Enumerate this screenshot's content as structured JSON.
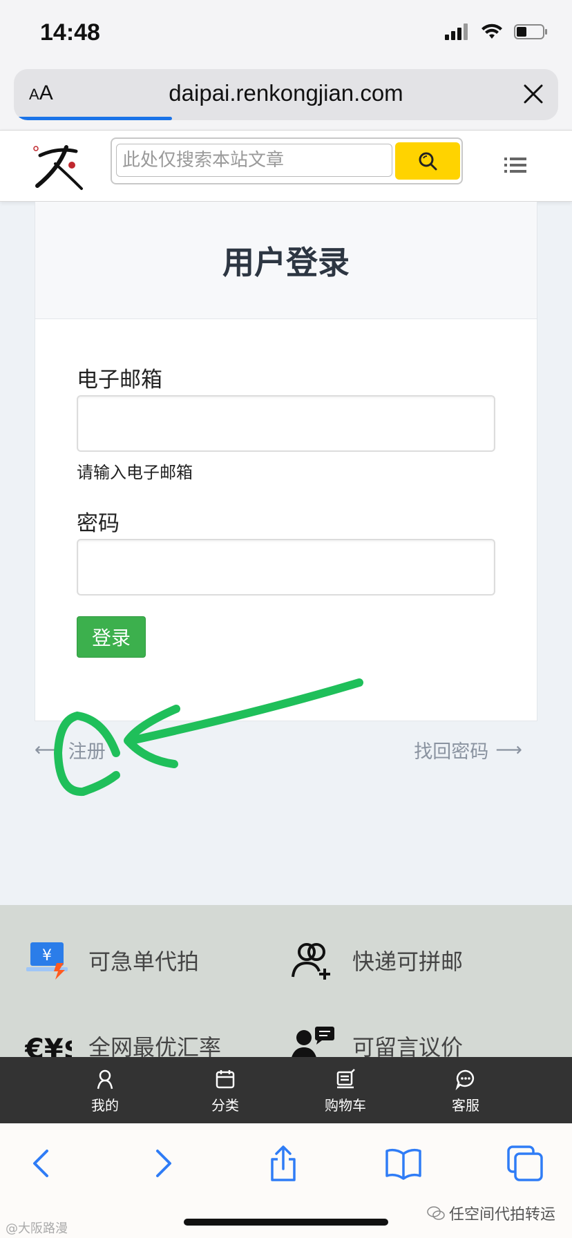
{
  "status_bar": {
    "time": "14:48"
  },
  "browser": {
    "aa_label_small": "A",
    "aa_label_big": "A",
    "url": "daipai.renkongjian.com",
    "load_progress": 0.29
  },
  "site_header": {
    "search_placeholder": "此处仅搜索本站文章",
    "search_icon": "search-icon",
    "menu_icon": "menu-list-icon",
    "accent_color": "#ffd300"
  },
  "login": {
    "title": "用户登录",
    "email_label": "电子邮箱",
    "email_help": "请输入电子邮箱",
    "email_value": "",
    "password_label": "密码",
    "password_value": "",
    "submit_label": "登录",
    "submit_color": "#3cb04d"
  },
  "links": {
    "left_arrow": "⟵",
    "register_label": "注册",
    "forgot_label": "找回密码",
    "right_arrow": "⟶"
  },
  "features": [
    {
      "icon": "yen-laptop-icon",
      "label": "可急单代拍"
    },
    {
      "icon": "users-plus-icon",
      "label": "快递可拼邮"
    },
    {
      "icon": "currency-exchange-icon",
      "label": "全网最优汇率"
    },
    {
      "icon": "user-message-icon",
      "label": "可留言议价"
    }
  ],
  "tabbar": [
    {
      "icon": "user-icon",
      "label": "我的"
    },
    {
      "icon": "category-icon",
      "label": "分类"
    },
    {
      "icon": "cart-icon",
      "label": "购物车"
    },
    {
      "icon": "chat-icon",
      "label": "客服"
    }
  ],
  "watermark": {
    "left": "@大阪路漫",
    "right": "任空间代拍转运"
  }
}
